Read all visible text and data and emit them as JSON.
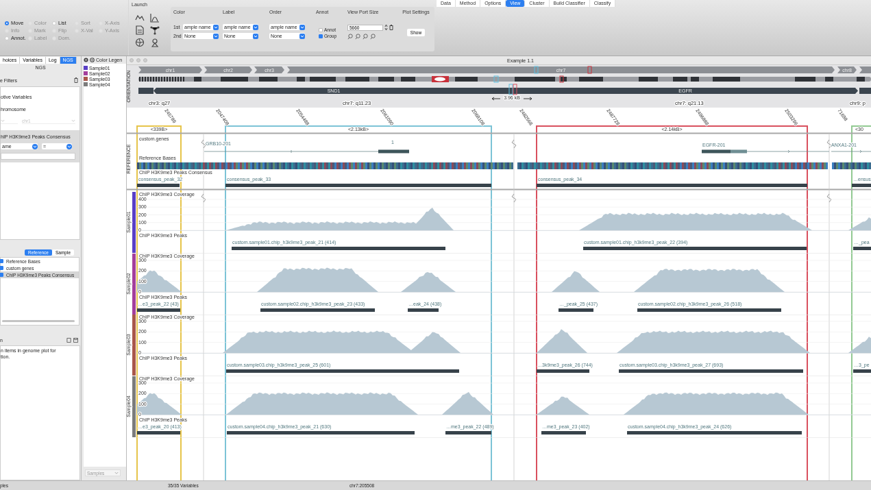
{
  "tabs": [
    {
      "label": "Data",
      "selected": false
    },
    {
      "label": "Method",
      "selected": false
    },
    {
      "label": "Options",
      "selected": false
    },
    {
      "label": "View",
      "selected": true
    },
    {
      "label": "Cluster",
      "selected": false
    },
    {
      "label": "Build Classifier",
      "selected": false
    },
    {
      "label": "Classify",
      "selected": false
    }
  ],
  "toolbar": {
    "modes": [
      {
        "label": "Move",
        "selected": true,
        "disabled": false
      },
      {
        "label": "Info",
        "selected": false,
        "disabled": true
      },
      {
        "label": "Annot.",
        "selected": false,
        "disabled": false
      },
      {
        "label": "Color",
        "selected": false,
        "disabled": true
      },
      {
        "label": "Mark",
        "selected": false,
        "disabled": true
      },
      {
        "label": "Label",
        "selected": false,
        "disabled": true
      },
      {
        "label": "List",
        "selected": false,
        "disabled": false
      },
      {
        "label": "Flip",
        "selected": false,
        "disabled": true
      },
      {
        "label": "Dom.",
        "selected": false,
        "disabled": true
      },
      {
        "label": "Sort",
        "selected": false,
        "disabled": true
      },
      {
        "label": "X-Val",
        "selected": false,
        "disabled": true
      },
      {
        "label": "X-Axis",
        "selected": false,
        "disabled": true
      },
      {
        "label": "Y-Axis",
        "selected": false,
        "disabled": true
      }
    ],
    "launch_title": "Launch",
    "selectors": [
      {
        "title": "Color",
        "rows": [
          {
            "label": "1st",
            "value": "ample name"
          },
          {
            "label": "2nd",
            "value": "None"
          }
        ]
      },
      {
        "title": "Label",
        "rows": [
          {
            "value": "ample name"
          },
          {
            "value": "None"
          }
        ]
      },
      {
        "title": "Order",
        "rows": [
          {
            "value": "ample name"
          },
          {
            "value": "None"
          }
        ]
      }
    ],
    "annot": {
      "title": "Annot",
      "checkboxes": [
        {
          "label": "Annot",
          "checked": false
        },
        {
          "label": "Group",
          "checked": true
        }
      ]
    },
    "viewport": {
      "title": "View Port Size",
      "value": "5660"
    },
    "plot_settings": {
      "title": "Plot Settings",
      "button": "Show"
    }
  },
  "left_panel": {
    "tabs": [
      {
        "label": "hoices",
        "selected": false
      },
      {
        "label": "Variables",
        "selected": false
      },
      {
        "label": "Log",
        "selected": false
      },
      {
        "label": "NGS",
        "selected": true
      }
    ],
    "subtitle": "NGS",
    "filters_title": "e Filters",
    "active_variables": "otive Variables",
    "chromosome_label": "hromosome",
    "chromosome_value": "chr1",
    "consensus_title": "hIP H3K9me3 Peaks Consensus",
    "field_select": "ame",
    "operator_select": "=",
    "track_tabs": [
      {
        "label": "Reference",
        "selected": true
      },
      {
        "label": "Sample",
        "selected": false
      }
    ],
    "tracks": [
      {
        "label": "Reference Bases",
        "checked": true,
        "selected": false
      },
      {
        "label": "custom genes",
        "checked": true,
        "selected": false
      },
      {
        "label": "ChIP H3K9me3 Peaks Consensus",
        "checked": true,
        "selected": true
      }
    ],
    "info_title": "n",
    "info_text": "n items in genome plot for\ntion."
  },
  "legend": {
    "title": "Color Legen",
    "items": [
      {
        "label": "Sample01",
        "color": "#5a3fc6"
      },
      {
        "label": "Sample02",
        "color": "#a43f9c"
      },
      {
        "label": "Sample03",
        "color": "#a9574b"
      },
      {
        "label": "Sample04",
        "color": "#7c7c7c"
      }
    ],
    "group_select": "Samples"
  },
  "plot": {
    "title": "Example 1.1",
    "section_labels": [
      "ORIENTATION",
      "REFERENCE"
    ],
    "chromosomes": [
      "chr1",
      "chr2",
      "chr3",
      "chr7",
      "chr8"
    ],
    "genes_band": [
      "SND1",
      "EGFR"
    ],
    "span_label": "3.96 kB",
    "cytobands": [
      "chr3: q27",
      "chr7: q11.23",
      "chr7: q21.13",
      "chr9: p"
    ],
    "positions": [
      "245789",
      "2047408",
      "2054488",
      "2061090",
      "2068108",
      "2482568",
      "2487728",
      "2496888",
      "2503296",
      "71698"
    ],
    "regions": [
      {
        "label": "<339B>",
        "color": "#e6c44a"
      },
      {
        "label": "<2.13kB>",
        "color": "#7cc3d6"
      },
      {
        "label": "<2.14kB>",
        "color": "#d9505e"
      },
      {
        "label": "<30",
        "color": "#92c992"
      }
    ],
    "genes_title": "custom.genes",
    "genes": [
      "GRB10-201",
      "1",
      "EGFR-201",
      "ANXA1-201"
    ],
    "bases_title": "Reference Bases",
    "consensus_title": "ChIP H3K9me3 Peaks Consensus",
    "consensus_peaks": [
      "consensus_peak_32",
      "consensus_peak_33",
      "consensus_peak_34",
      "…ensus"
    ],
    "samples": [
      {
        "name": "Sample01",
        "color": "#5a3fc6",
        "coverage_title": "ChIP H3K9me3 Coverage",
        "yticks": [
          "400",
          "300",
          "200",
          "100",
          "0"
        ],
        "peaks_title": "ChIP H3K9me3 Peaks",
        "peaks": [
          "custom.sample01.chip_h3k9me3_peak_21 (414)",
          "custom.sample01.chip_h3k9me3_peak_22 (394)",
          "…_pea"
        ]
      },
      {
        "name": "Sample02",
        "color": "#a43f9c",
        "coverage_title": "ChIP H3K9me3 Coverage",
        "yticks": [
          "300",
          "200",
          "100",
          "0"
        ],
        "peaks_title": "ChIP H3K9me3 Peaks",
        "peaks": [
          "…e3_peak_22 (43)",
          "custom.sample02.chip_h3k9me3_peak_23 (433)",
          "…eak_24 (438)",
          "…_peak_25 (437)",
          "custom.sample02.chip_h3k9me3_peak_26 (518)"
        ]
      },
      {
        "name": "Sample03",
        "color": "#a9574b",
        "coverage_title": "ChIP H3K9me3 Coverage",
        "yticks": [
          "300",
          "200",
          "100",
          "0"
        ],
        "peaks_title": "ChIP H3K9me3 Peaks",
        "peaks": [
          "custom.sample03.chip_h3k9me3_peak_25 (601)",
          "…3k9me3_peak_26 (744)",
          "custom.sample03.chip_h3k9me3_peak_27 (693)",
          "…3_pe"
        ]
      },
      {
        "name": "Sample04",
        "color": "#7c7c7c",
        "coverage_title": "ChIP H3K9me3 Coverage",
        "yticks": [
          "300",
          "200",
          "100",
          "0"
        ],
        "peaks_title": "ChIP H3K9me3 Peaks",
        "peaks": [
          "…e3_peak_20 (413)",
          "custom.sample04.chip_h3k9me3_peak_21 (630)",
          "…me3_peak_22 (489)",
          "…me3_peak_23 (402)",
          "custom.sample04.chip_h3k9me3_peak_24 (626)"
        ]
      }
    ]
  },
  "status_bar": [
    "ples",
    "35/35 Variables",
    "chr7:205508"
  ]
}
